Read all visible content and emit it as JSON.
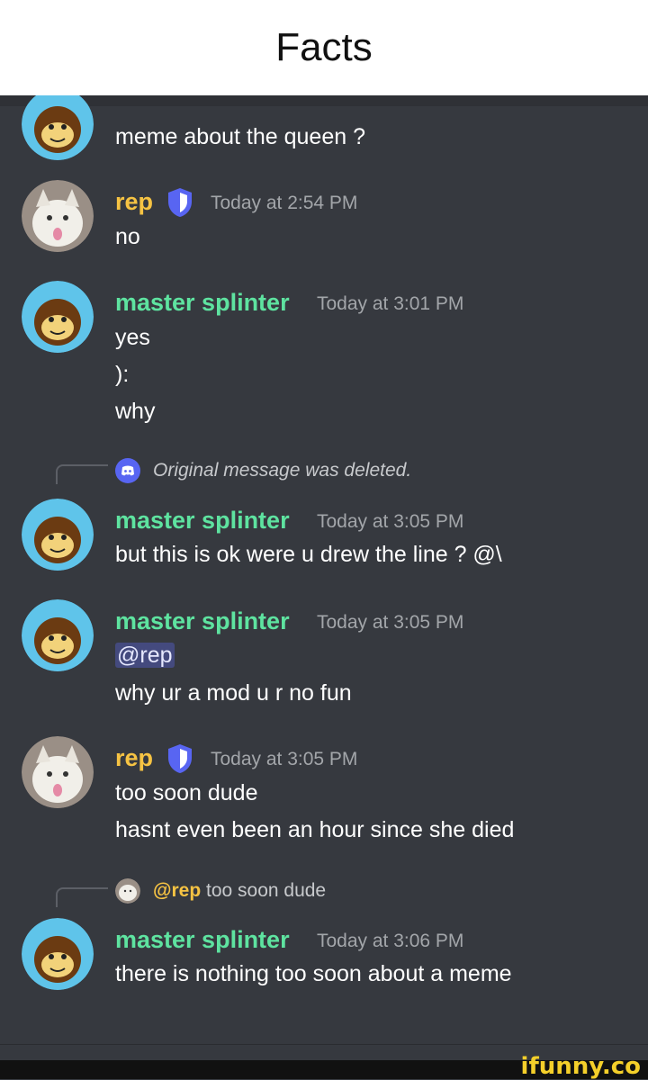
{
  "header": {
    "title": "Facts"
  },
  "messages": {
    "m0": {
      "text": "meme about the queen ?"
    },
    "m1": {
      "author": "rep",
      "time": "Today at 2:54 PM",
      "lines": [
        "no"
      ]
    },
    "m2": {
      "author": "master splinter",
      "time": "Today at 3:01 PM",
      "lines": [
        "yes",
        "):",
        "why"
      ]
    },
    "r1": {
      "text": "Original message was deleted."
    },
    "m3": {
      "author": "master splinter",
      "time": "Today at 3:05 PM",
      "lines": [
        "but this is ok were u drew the line ? @\\"
      ]
    },
    "m4": {
      "author": "master splinter",
      "time": "Today at 3:05 PM",
      "mention": "@rep",
      "lines": [
        "why ur a mod u r no fun"
      ]
    },
    "m5": {
      "author": "rep",
      "time": "Today at 3:05 PM",
      "lines": [
        "too soon dude",
        "hasnt even been an hour since she died"
      ]
    },
    "r2": {
      "mention": "@rep",
      "text": "too soon dude"
    },
    "m6": {
      "author": "master splinter",
      "time": "Today at 3:06 PM",
      "lines": [
        "there is nothing  too soon about a meme"
      ]
    }
  },
  "watermark": {
    "text": "ifunny.co"
  },
  "colors": {
    "background": "#36393f",
    "master_splinter": "#5ee3a0",
    "rep": "#f6c343",
    "mention_bg": "#444a7e",
    "shield": "#5865f2"
  }
}
